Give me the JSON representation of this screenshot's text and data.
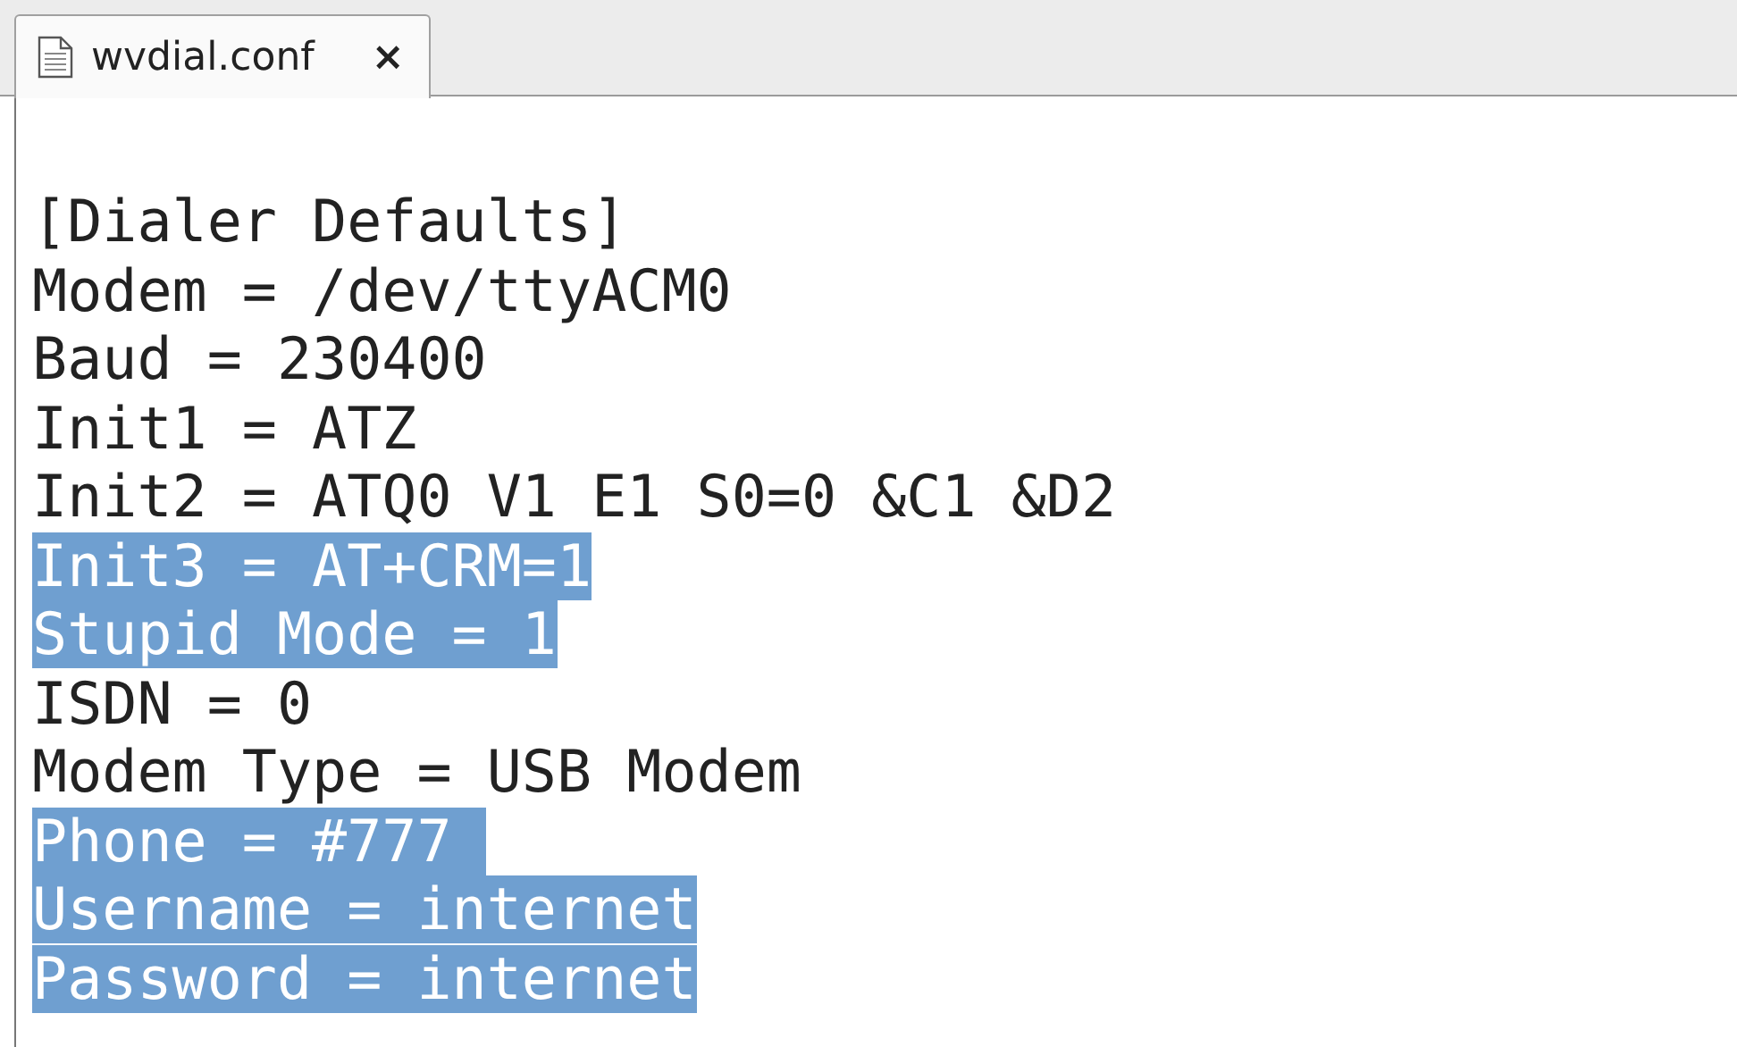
{
  "tabs": [
    {
      "label": "wvdial.conf",
      "close": "×",
      "selected": true
    }
  ],
  "editor": {
    "lines": [
      {
        "text": "[Dialer Defaults]",
        "selected": false
      },
      {
        "text": "Modem = /dev/ttyACM0",
        "selected": false
      },
      {
        "text": "Baud = 230400",
        "selected": false
      },
      {
        "text": "Init1 = ATZ",
        "selected": false
      },
      {
        "text": "Init2 = ATQ0 V1 E1 S0=0 &C1 &D2",
        "selected": false
      },
      {
        "text": "Init3 = AT+CRM=1",
        "selected": true
      },
      {
        "text": "Stupid Mode = 1",
        "selected": true
      },
      {
        "text": "ISDN = 0",
        "selected": false
      },
      {
        "text": "Modem Type = USB Modem",
        "selected": false
      },
      {
        "text": "Phone = #777 ",
        "selected": true
      },
      {
        "text": "Username = internet",
        "selected": true
      },
      {
        "text": "Password = internet",
        "selected": true
      }
    ]
  }
}
